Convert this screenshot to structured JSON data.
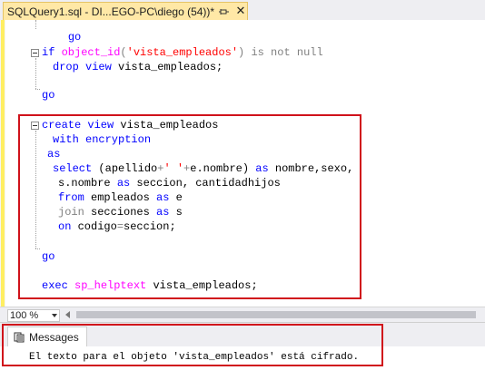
{
  "tab": {
    "title": "SQLQuery1.sql - DI...EGO-PC\\diego (54))*",
    "pin_icon": "pin-icon",
    "close_glyph": "✕"
  },
  "code": {
    "line1": "go",
    "line3_kw": "if",
    "line3_fn": "object_id",
    "line3_open": "(",
    "line3_str": "'vista_empleados'",
    "line3_close": ")",
    "line3_rest": "is not null",
    "line4_kw": "drop view",
    "line4_rest": "vista_empleados;",
    "line6": "go",
    "line8_kw": "create view",
    "line8_rest": "vista_empleados",
    "line9": "with encryption",
    "line10": "as",
    "line11_a": "select",
    "line11_b": "(apellido",
    "line11_c": "+",
    "line11_d": "' '",
    "line11_e": "+",
    "line11_f": "e.nombre)",
    "line11_g": "as",
    "line11_h": "nombre,sexo,",
    "line12_a": "s.nombre",
    "line12_b": "as",
    "line12_c": "seccion, cantidadhijos",
    "line13_a": "from",
    "line13_b": "empleados",
    "line13_c": "as",
    "line13_d": "e",
    "line14_a": "join",
    "line14_b": "secciones",
    "line14_c": "as",
    "line14_d": "s",
    "line15_a": "on",
    "line15_b": "codigo",
    "line15_c": "=",
    "line15_d": "seccion;",
    "line17": "go",
    "line19_a": "exec",
    "line19_b": "sp_helptext",
    "line19_c": "vista_empleados;"
  },
  "zoom": {
    "value": "100 %"
  },
  "results": {
    "tab_label": "Messages",
    "tab_icon": "messages-icon",
    "message": "El texto para el objeto 'vista_empleados' está cifrado."
  },
  "colors": {
    "keyword": "#0000ff",
    "function": "#ff00ff",
    "string": "#ff0000",
    "operator": "#808080",
    "highlight_box": "#d0121b",
    "active_tab": "#ffe8a6"
  }
}
